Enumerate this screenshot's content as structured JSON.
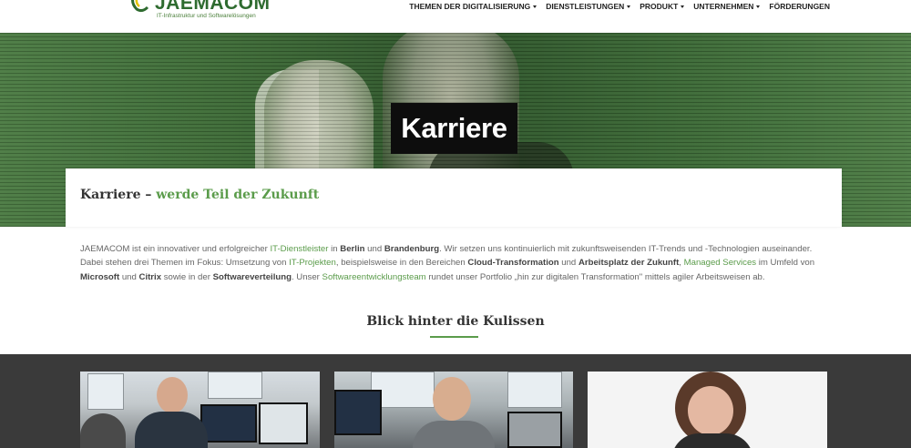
{
  "brand": {
    "name": "JAEMACOM",
    "tagline": "IT-Infrastruktur und Softwarelösungen",
    "color": "#2e6b2f"
  },
  "nav": {
    "items": [
      {
        "label": "THEMEN DER DIGITALISIERUNG",
        "dropdown": true
      },
      {
        "label": "DIENSTLEISTUNGEN",
        "dropdown": true
      },
      {
        "label": "PRODUKT",
        "dropdown": true
      },
      {
        "label": "UNTERNEHMEN",
        "dropdown": true
      },
      {
        "label": "FÖRDERUNGEN",
        "dropdown": false
      }
    ]
  },
  "hero": {
    "title": "Karriere"
  },
  "card": {
    "title_prefix": "Karriere – ",
    "title_accent": "werde Teil der Zukunft"
  },
  "intro": {
    "t1": "JAEMACOM ist ein innovativer und erfolgreicher ",
    "l1": "IT-Dienstleister",
    "t2": " in ",
    "b1": "Berlin",
    "t3": " und ",
    "b2": "Brandenburg",
    "t4": ". Wir setzen uns kontinuierlich mit zukunftsweisenden IT-Trends und -Technologien auseinander. Dabei stehen drei Themen im Fokus: Umsetzung von ",
    "l2": "IT-Projekten",
    "t5": ", beispielsweise in den Bereichen ",
    "b3": "Cloud-Transformation",
    "t6": " und ",
    "b4": "Arbeitsplatz der Zukunft",
    "t7": ", ",
    "l3": "Managed Services",
    "t8": " im Umfeld von ",
    "b5": "Microsoft",
    "t9": " und ",
    "b6": "Citrix",
    "t10": " sowie in der ",
    "b7": "Softwareverteilung",
    "t11": ". Unser ",
    "l4": "Softwareentwicklungsteam",
    "t12": " rundet unser Portfolio „hin zur digitalen Transformation\" mittels agiler Arbeitsweisen ab."
  },
  "section": {
    "title": "Blick hinter die Kulissen"
  },
  "colors": {
    "accent": "#5b9c4b",
    "gallery_bg": "#3a3a3a",
    "hero_title_bg": "#0d0d0d"
  }
}
